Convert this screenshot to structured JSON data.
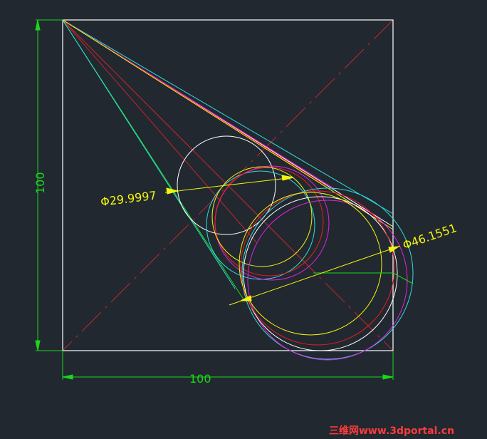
{
  "colors": {
    "background": "#212830",
    "dimension": "#19d819",
    "frame": "#ffffff",
    "centerline": "#c0262a",
    "cyan": "#2fdcdc",
    "yellow": "#f4f40c",
    "magenta": "#e222e2",
    "red": "#ee1c1c",
    "white_circle": "#ffffff",
    "diameter_label": "#f4f40c",
    "watermark": "#ff3b3b"
  },
  "dimensions": {
    "vertical_label": "100",
    "horizontal_label": "100"
  },
  "diameter_labels": {
    "small": "Φ29.9997",
    "large": "Φ46.1551"
  },
  "watermark": {
    "chinese": "三维网",
    "url": "www.3dportal.cn"
  }
}
